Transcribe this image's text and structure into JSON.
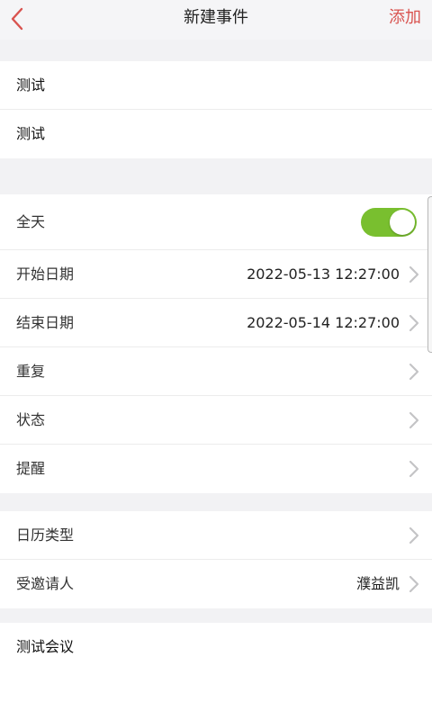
{
  "header": {
    "title": "新建事件",
    "add_label": "添加",
    "back_icon": "chevron-left-icon",
    "accent_color": "#d9534f"
  },
  "basic": {
    "title_value": "测试",
    "location_value": "测试"
  },
  "time": {
    "all_day_label": "全天",
    "all_day_on": true,
    "toggle_color": "#79bf2f",
    "start_label": "开始日期",
    "start_value": "2022-05-13 12:27:00",
    "end_label": "结束日期",
    "end_value": "2022-05-14 12:27:00",
    "repeat_label": "重复",
    "status_label": "状态",
    "reminder_label": "提醒"
  },
  "calendar": {
    "type_label": "日历类型",
    "invitee_label": "受邀请人",
    "invitee_value": "濮益凯"
  },
  "notes": {
    "text": "测试会议"
  }
}
